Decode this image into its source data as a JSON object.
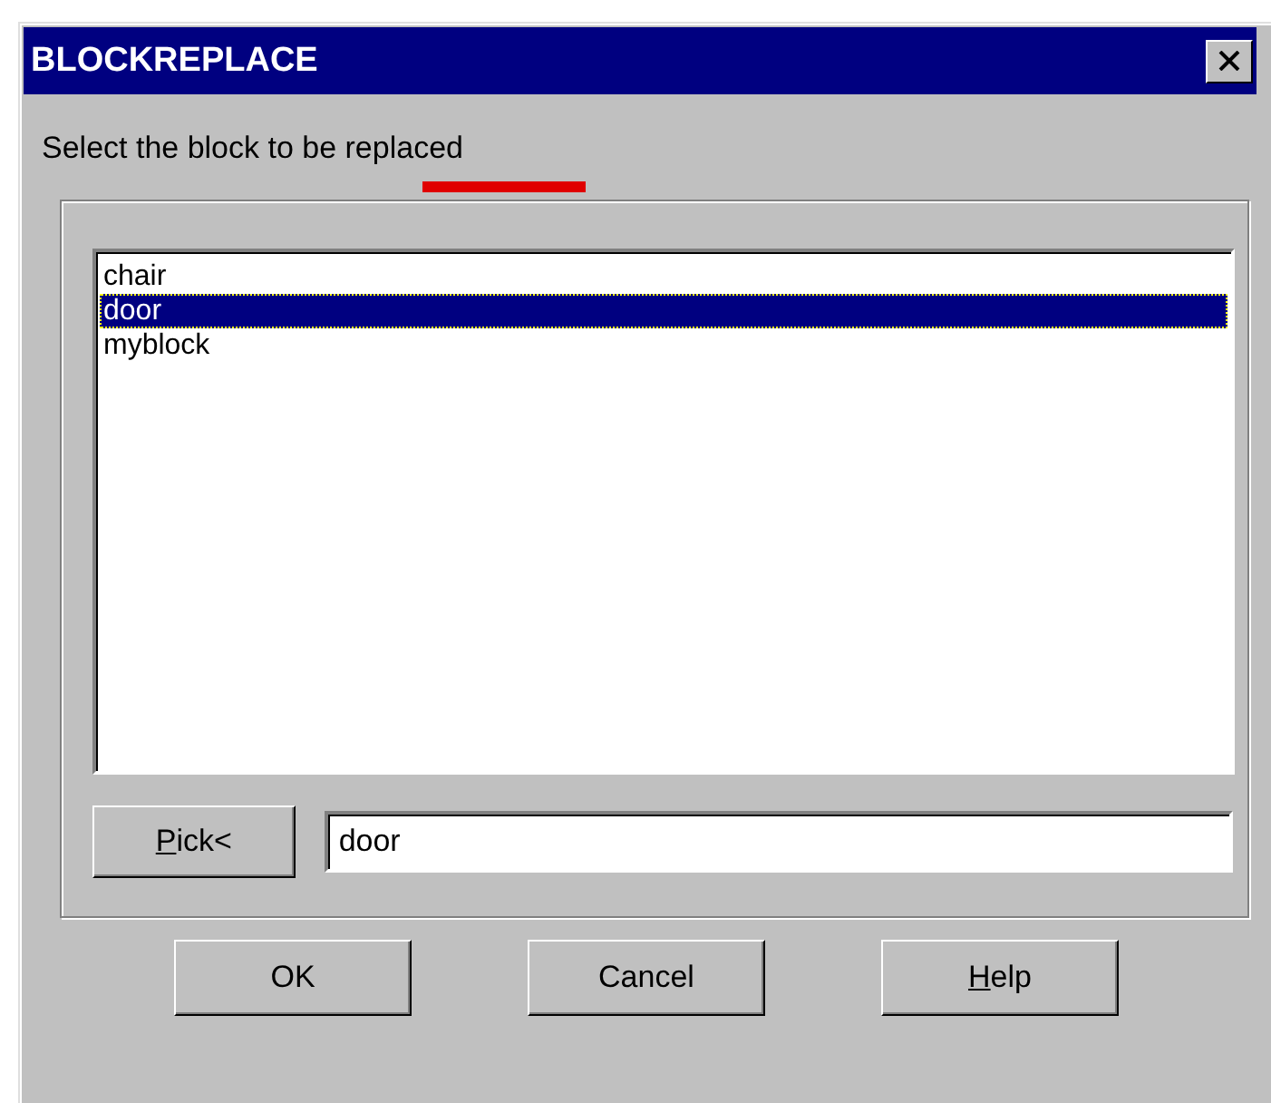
{
  "window": {
    "title": "BLOCKREPLACE"
  },
  "prompt": "Select the block to be replaced",
  "block_list": {
    "items": [
      {
        "label": "chair",
        "selected": false
      },
      {
        "label": "door",
        "selected": true
      },
      {
        "label": "myblock",
        "selected": false
      }
    ]
  },
  "pick_button": {
    "label": "Pick<",
    "mnemonic_first": true
  },
  "block_name_field": {
    "value": "door"
  },
  "buttons": [
    {
      "label": "OK",
      "mnemonic_first": false
    },
    {
      "label": "Cancel",
      "mnemonic_first": false
    },
    {
      "label": "Help",
      "mnemonic_first": true
    }
  ]
}
